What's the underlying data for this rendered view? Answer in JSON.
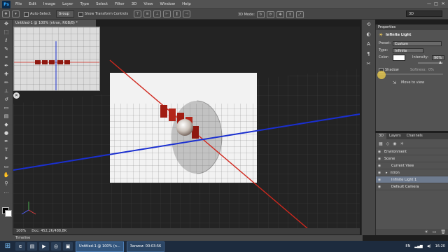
{
  "app": {
    "logo": "Ps",
    "menus": [
      "File",
      "Edit",
      "Image",
      "Layer",
      "Type",
      "Select",
      "Filter",
      "3D",
      "View",
      "Window",
      "Help"
    ]
  },
  "window_controls": [
    "—",
    "□",
    "✕"
  ],
  "options": {
    "auto_select_label": "Auto-Select:",
    "group_value": "Group",
    "show_transform_label": "Show Transform Controls",
    "mode_3d_label": "3D Mode:",
    "workspace": "3D"
  },
  "document": {
    "tab_title": "Untitled-1 @ 100% (ntron, RGB/8) *",
    "zoom": "100%",
    "doc_size": "Doc: 452,2K/488,8K"
  },
  "timeline_label": "Timeline",
  "properties": {
    "tab": "Properties",
    "title": "Infinite Light",
    "preset_label": "Preset:",
    "preset_value": "Custom",
    "type_label": "Type:",
    "type_value": "Infinite",
    "color_label": "Color:",
    "intensity_label": "Intensity:",
    "intensity_value": "90%",
    "shadow_label": "Shadow",
    "softness_label": "Softness:",
    "softness_value": "0%",
    "move_to_view": "Move to view"
  },
  "layers_panel": {
    "tabs": [
      "3D",
      "Layers",
      "Channels"
    ],
    "rows": [
      {
        "name": "Environment",
        "indent": 0,
        "selected": false
      },
      {
        "name": "Scene",
        "indent": 0,
        "selected": false
      },
      {
        "name": "Current View",
        "indent": 1,
        "selected": false
      },
      {
        "name": "ntron",
        "indent": 1,
        "selected": false
      },
      {
        "name": "Infinite Light 1",
        "indent": 1,
        "selected": true
      },
      {
        "name": "Default Camera",
        "indent": 1,
        "selected": false
      }
    ]
  },
  "taskbar": {
    "task_ps": "Untitled-1 @ 100% (n...",
    "task_rec": "Записи:  00:03:56",
    "lang": "EN",
    "time": "16:20"
  },
  "colors": {
    "accent_grid_red": "#d0281e",
    "accent_grid_blue": "#1a2fd0",
    "panel_bg": "#535353"
  }
}
